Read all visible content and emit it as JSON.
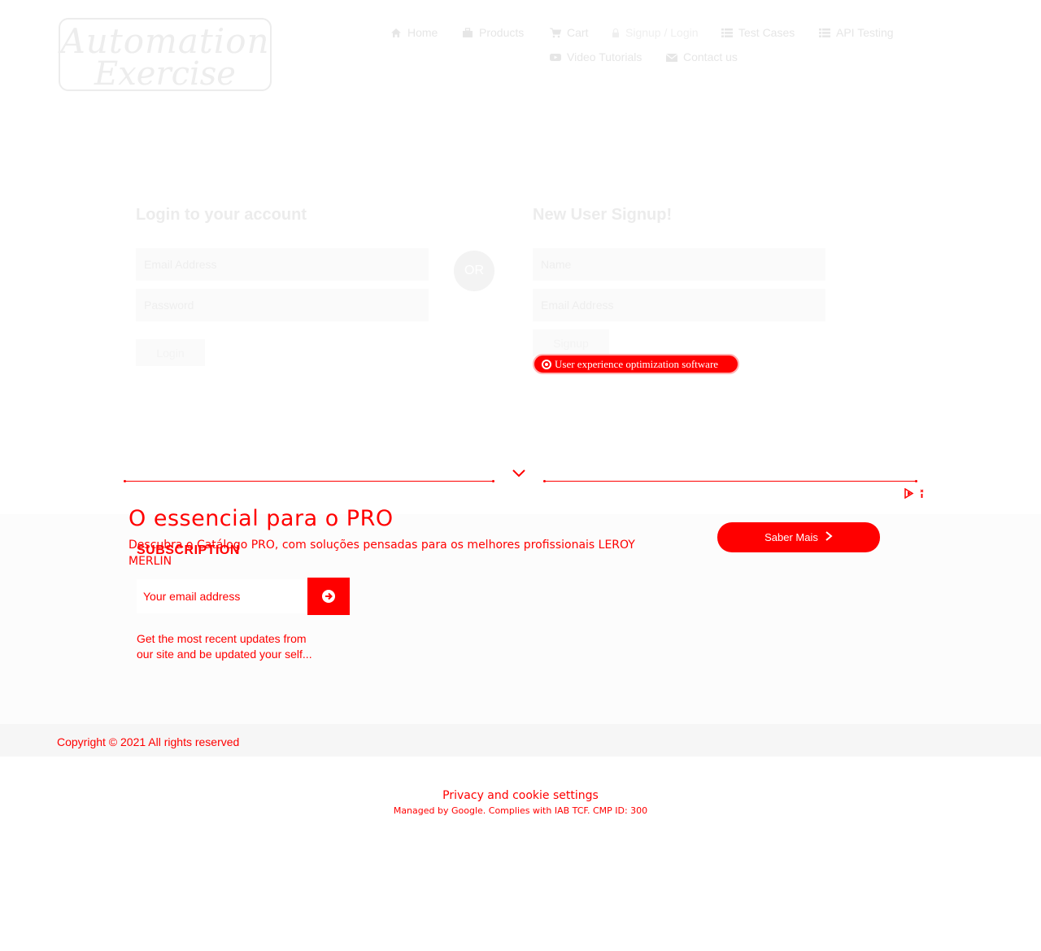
{
  "logo": {
    "line1": "Automation",
    "line2": "Exercise"
  },
  "nav": [
    {
      "label": "Home",
      "icon": "home-icon"
    },
    {
      "label": "Products",
      "icon": "shop-icon"
    },
    {
      "label": "Cart",
      "icon": "cart-icon"
    },
    {
      "label": "Signup / Login",
      "icon": "lock-icon",
      "active": true
    },
    {
      "label": "Test Cases",
      "icon": "list-icon"
    },
    {
      "label": "API Testing",
      "icon": "list-icon"
    },
    {
      "label": "Video Tutorials",
      "icon": "youtube-icon"
    },
    {
      "label": "Contact us",
      "icon": "envelope-icon"
    }
  ],
  "login": {
    "title": "Login to your account",
    "email_placeholder": "Email Address",
    "password_placeholder": "Password",
    "button": "Login"
  },
  "or_label": "OR",
  "signup": {
    "title": "New User Signup!",
    "name_placeholder": "Name",
    "email_placeholder": "Email Address",
    "button": "Signup"
  },
  "ad_badge": "User experience optimization software",
  "ad": {
    "headline": "O essencial para o PRO",
    "description": "Descubra o Catálogo PRO, com soluções pensadas para os melhores profissionais LEROY MERLIN",
    "cta": "Saber Mais",
    "accent": "#ff0000"
  },
  "subscription": {
    "title": "SUBSCRIPTION",
    "email_placeholder": "Your email address",
    "note": "Get the most recent updates from our site and be updated your self..."
  },
  "footer": {
    "copyright": "Copyright © 2021 All rights reserved"
  },
  "consent": {
    "link": "Privacy and cookie settings",
    "managed": "Managed by Google. Complies with IAB TCF. CMP ID: 300"
  }
}
